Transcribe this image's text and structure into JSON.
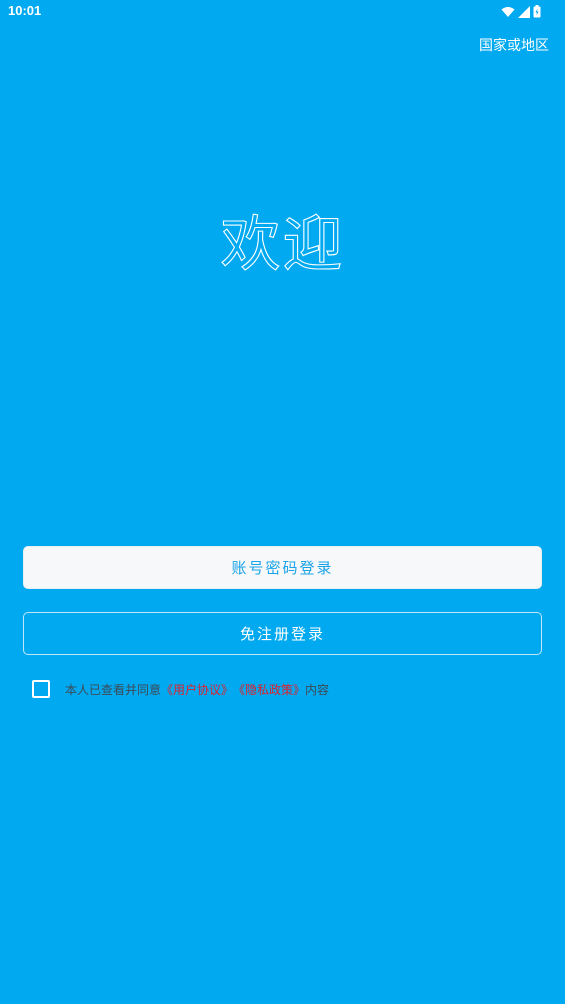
{
  "status_bar": {
    "time": "10:01",
    "icons": [
      "wifi-icon",
      "signal-icon",
      "battery-icon"
    ]
  },
  "header": {
    "region_label": "国家或地区"
  },
  "main": {
    "title": "欢迎",
    "password_login_label": "账号密码登录",
    "quick_login_label": "免注册登录"
  },
  "agreement": {
    "checked": false,
    "prefix": "本人已查看并同意",
    "user_agreement": "《用户协议》",
    "privacy_policy": "《隐私政策》",
    "suffix": "内容"
  },
  "colors": {
    "background": "#00a9f0",
    "primary_text": "#1aa3e8",
    "link": "#e0202c"
  }
}
